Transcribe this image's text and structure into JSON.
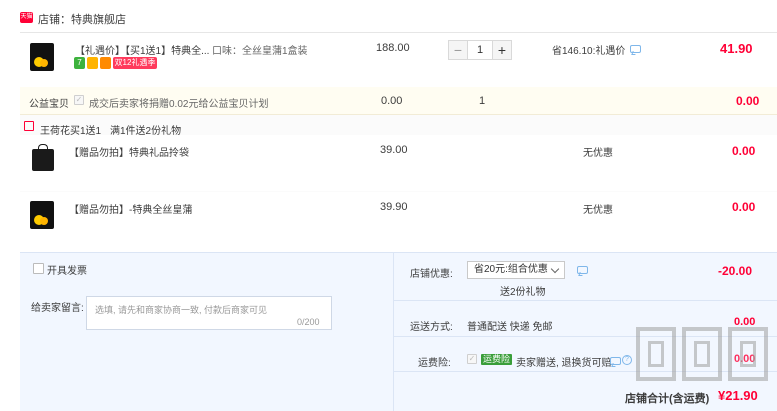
{
  "shop": {
    "badge": "天猫",
    "name": "店铺：特典旗舰店"
  },
  "item1": {
    "title": "【礼遇价】【买1送1】特典全...",
    "spec": "口味：全丝皇蒲1盒装",
    "price": "188.00",
    "quantity": "1",
    "saving": "省146.10:礼遇价",
    "total": "41.90",
    "tags": [
      "7",
      "",
      "",
      "双12礼遇季"
    ]
  },
  "charity": {
    "label": "公益宝贝",
    "text": "成交后卖家将捐赠0.02元给公益宝贝计划",
    "price": "0.00",
    "quantity": "1",
    "total": "0.00"
  },
  "gift_header": {
    "title": "王荷花买1送1",
    "subtitle": "满1件送2份礼物"
  },
  "gifts": [
    {
      "title": "【赠品勿拍】特典礼品拎袋",
      "price": "39.00",
      "discount": "无优惠",
      "total": "0.00"
    },
    {
      "title": "【赠品勿拍】-特典全丝皇蒲",
      "price": "39.90",
      "discount": "无优惠",
      "total": "0.00"
    }
  ],
  "bottom": {
    "invoice_label": "开具发票",
    "note_label": "给卖家留言:",
    "note_placeholder": "选填, 请先和商家协商一致, 付款后商家可见",
    "note_counter": "0/200",
    "shop_discount_label": "店铺优惠:",
    "shop_discount_value": "省20元:组合优惠",
    "shop_discount_sub": "送2份礼物",
    "shop_discount_total": "-20.00",
    "shipping_label": "运送方式:",
    "shipping_value": "普通配送 快递 免邮",
    "shipping_total": "0.00",
    "insurance_label": "运费险:",
    "insurance_tag": "运费险",
    "insurance_text": "卖家赠送, 退换货可赔",
    "insurance_total": "0.00",
    "sum_label": "店铺合计(含运费)",
    "sum_value": "¥21.90"
  },
  "watermark": "值 什么值得买",
  "colors": {
    "accent": "#ff0036",
    "link": "#7fb7ea",
    "bottom_bg": "#f2f7ff"
  }
}
